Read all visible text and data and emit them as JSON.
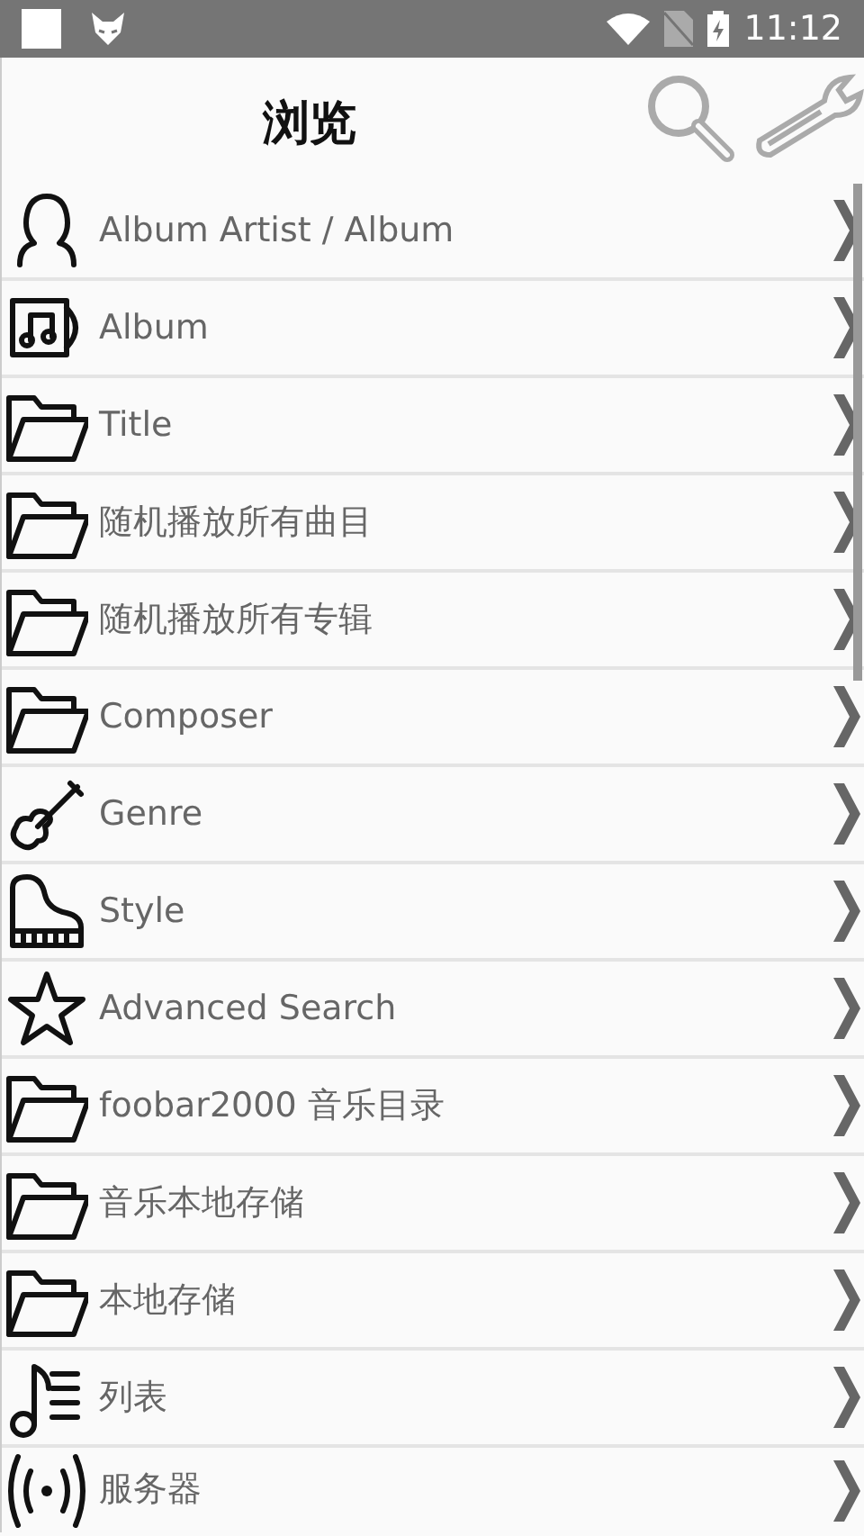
{
  "status_bar": {
    "time": "11:12"
  },
  "header": {
    "title": "浏览"
  },
  "items": [
    {
      "kind": "person",
      "label": "Album Artist / Album"
    },
    {
      "kind": "album",
      "label": "Album"
    },
    {
      "kind": "folder",
      "label": "Title"
    },
    {
      "kind": "folder",
      "label": "随机播放所有曲目"
    },
    {
      "kind": "folder",
      "label": "随机播放所有专辑"
    },
    {
      "kind": "folder",
      "label": "Composer"
    },
    {
      "kind": "violin",
      "label": "Genre"
    },
    {
      "kind": "piano",
      "label": "Style"
    },
    {
      "kind": "star",
      "label": "Advanced Search"
    },
    {
      "kind": "folder",
      "label": "foobar2000 音乐目录"
    },
    {
      "kind": "folder",
      "label": "音乐本地存储"
    },
    {
      "kind": "folder",
      "label": "本地存储"
    },
    {
      "kind": "playlist",
      "label": "列表"
    },
    {
      "kind": "server",
      "label": "服务器"
    }
  ]
}
